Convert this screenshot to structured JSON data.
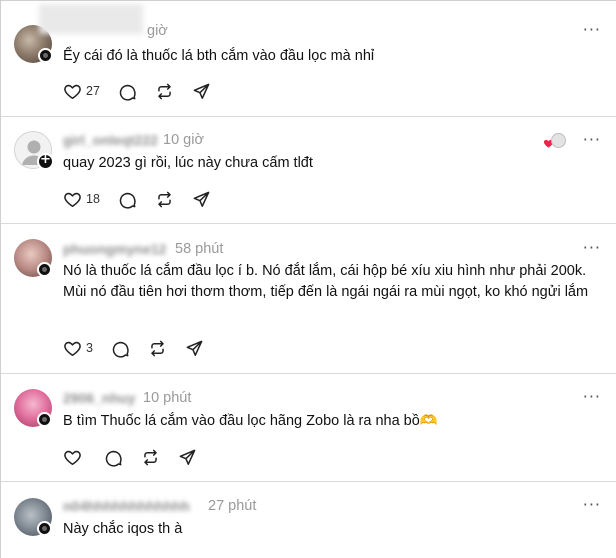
{
  "colors": {
    "like_heart": "#e8264a",
    "text": "#111111",
    "meta": "#9a9a9a",
    "divider": "#d9d9d9"
  },
  "icons": {
    "like": "heart-icon",
    "reply": "comment-bubble-icon",
    "repost": "repost-icon",
    "share": "send-icon",
    "more": "more-dots-icon"
  },
  "posts": [
    {
      "username": "",
      "time": "giờ",
      "text": "Ểy cái đó là thuốc lá bth cắm vào đầu lọc mà nhỉ",
      "likes": "27",
      "more": "···"
    },
    {
      "username": "girl_onleqt222",
      "time": "10 giờ",
      "text": "quay 2023 gì rồi, lúc này chưa cấm tlđt",
      "likes": "18",
      "more": "···"
    },
    {
      "username": "phuongmyne12",
      "time": "58 phút",
      "text": "Nó là thuốc lá cắm đầu lọc í b. Nó đắt lắm, cái hộp bé xíu xiu hình như phải 200k. Mùi nó đầu tiên hơi thơm thơm, tiếp đến là ngái ngái ra mùi ngọt, ko khó ngửi lắm",
      "likes": "3",
      "more": "···"
    },
    {
      "username": "2906_nhuy",
      "time": "10 phút",
      "text": "B tìm Thuốc lá cắm vào đầu lọc hãng Zobo là ra nha bồ🫶",
      "likes": "",
      "more": "···"
    },
    {
      "username": "n04hhhhhhhhhhhh",
      "time": "27 phút",
      "text": "Này chắc iqos th à",
      "likes": "",
      "more": "···"
    }
  ]
}
